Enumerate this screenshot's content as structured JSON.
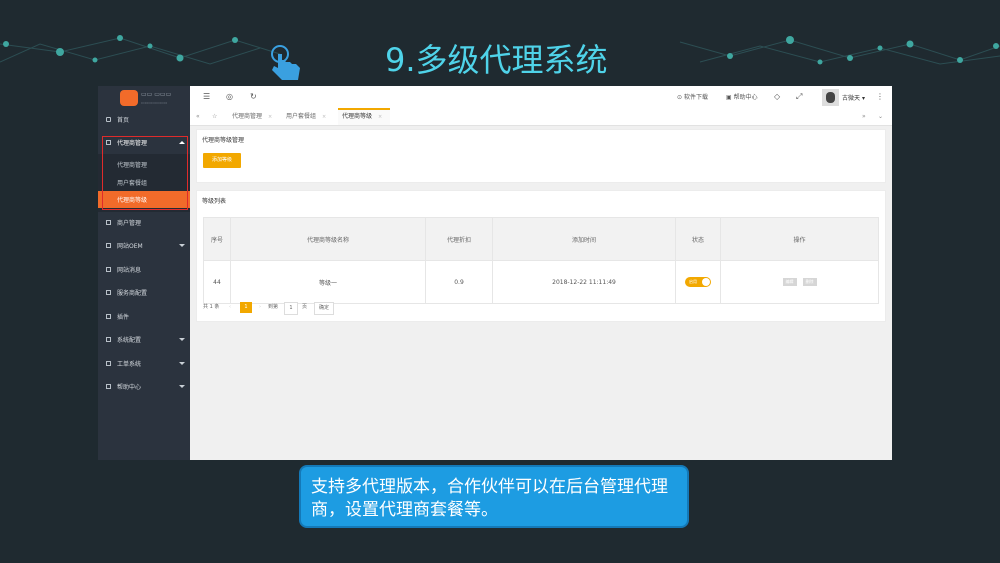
{
  "slide": {
    "title": "9.多级代理系统",
    "caption": "支持多代理版本，合作伙伴可以在后台管理代理商，设置代理商套餐等。"
  },
  "sidebar": {
    "items": [
      {
        "label": "首页",
        "icon": "home-icon"
      },
      {
        "label": "代理商管理",
        "icon": "grid-icon",
        "expanded": true
      },
      {
        "label": "商户管理",
        "icon": "grid-icon"
      },
      {
        "label": "网站OEM",
        "icon": "grid-icon"
      },
      {
        "label": "网站消息",
        "icon": "grid-icon"
      },
      {
        "label": "服务商配置",
        "icon": "grid-icon"
      },
      {
        "label": "插件",
        "icon": "grid-icon"
      },
      {
        "label": "系统配置",
        "icon": "grid-icon"
      },
      {
        "label": "工单系统",
        "icon": "grid-icon"
      },
      {
        "label": "帮助中心",
        "icon": "grid-icon"
      }
    ],
    "sub_items": [
      {
        "label": "代理商管理"
      },
      {
        "label": "用户套餐组"
      },
      {
        "label": "代理商等级",
        "active": true
      }
    ]
  },
  "topbar": {
    "download_label": "软件下载",
    "help_label": "帮助中心",
    "user_name": "古微天"
  },
  "tabs": [
    {
      "label": "代理商管理"
    },
    {
      "label": "用户套餐组"
    },
    {
      "label": "代理商等级",
      "active": true
    }
  ],
  "level_panel": {
    "title": "代理商等级管理",
    "add_button": "添加等级"
  },
  "list_panel": {
    "title": "等级列表",
    "columns": [
      "序号",
      "代理商等级名称",
      "代理折扣",
      "添加时间",
      "状态",
      "操作"
    ],
    "rows": [
      {
        "id": "44",
        "name": "等级一",
        "discount": "0.9",
        "created": "2018-12-22 11:11:49",
        "status": "启用",
        "edit": "编辑",
        "delete": "删除"
      }
    ]
  },
  "pager": {
    "total": "共 1 条",
    "current_page": "1",
    "goto_label": "到第",
    "goto_value": "1",
    "page_unit": "页",
    "confirm": "确定"
  },
  "colors": {
    "accent": "#f2a800",
    "active_nav": "#f26b2a",
    "title": "#4fd3e9",
    "caption_bg": "#1d9ce2"
  }
}
